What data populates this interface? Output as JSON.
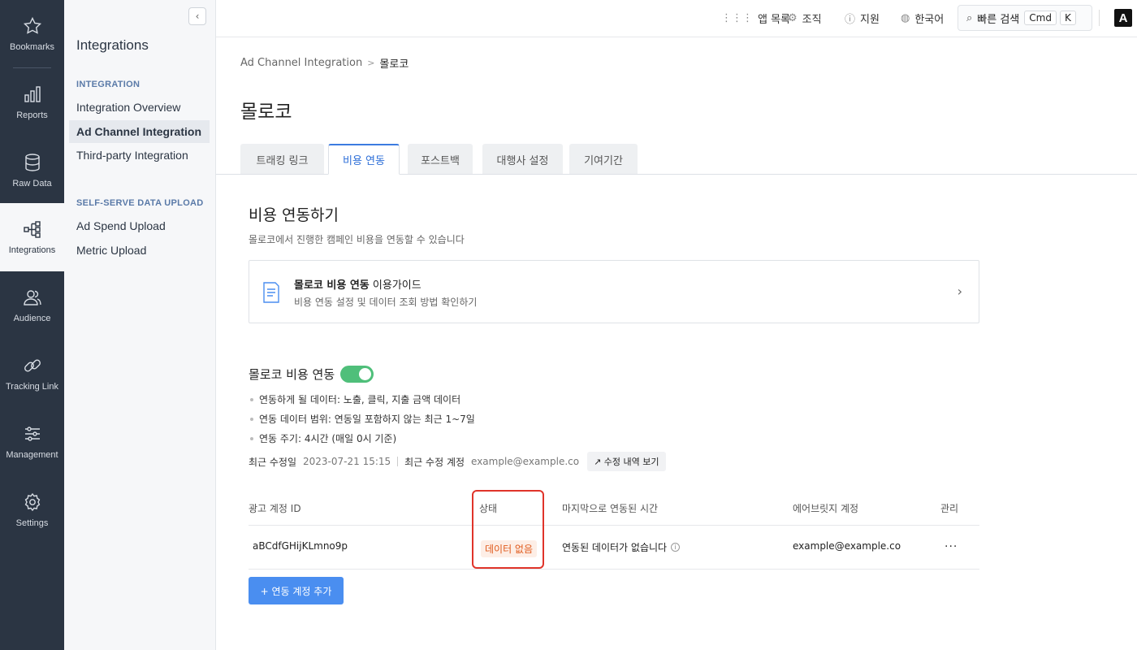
{
  "nav": {
    "items": [
      {
        "label": "Bookmarks",
        "icon": "star-icon"
      },
      {
        "label": "Reports",
        "icon": "bar-chart-icon"
      },
      {
        "label": "Raw Data",
        "icon": "database-icon"
      },
      {
        "label": "Integrations",
        "icon": "integration-icon",
        "active": true
      },
      {
        "label": "Audience",
        "icon": "users-icon"
      },
      {
        "label": "Tracking Link",
        "icon": "link-icon"
      },
      {
        "label": "Management",
        "icon": "sliders-icon"
      },
      {
        "label": "Settings",
        "icon": "gear-icon"
      }
    ]
  },
  "sidebar": {
    "collapse_glyph": "‹",
    "title": "Integrations",
    "section1": "INTEGRATION",
    "items1": [
      "Integration Overview",
      "Ad Channel Integration",
      "Third-party Integration"
    ],
    "section2": "SELF-SERVE DATA UPLOAD",
    "items2": [
      "Ad Spend Upload",
      "Metric Upload"
    ]
  },
  "topbar": {
    "app_list": "앱 목록",
    "org": "조직",
    "support": "지원",
    "language": "한국어",
    "search": "빠른 검색",
    "kbd1": "Cmd",
    "kbd2": "K",
    "logo": "A"
  },
  "breadcrumb": {
    "parent": "Ad Channel Integration",
    "sep": ">",
    "current": "몰로코"
  },
  "page_title": "몰로코",
  "tabs": [
    "트래킹 링크",
    "비용 연동",
    "포스트백",
    "대행사 설정",
    "기여기간"
  ],
  "section": {
    "title": "비용 연동하기",
    "subtitle": "몰로코에서 진행한 캠페인 비용을 연동할 수 있습니다"
  },
  "guide": {
    "title_bold": "몰로코 비용 연동",
    "title_rest": " 이용가이드",
    "subtitle": "비용 연동 설정 및 데이터 조회 방법 확인하기",
    "chevron": "›"
  },
  "integration": {
    "title": "몰로코 비용 연동",
    "enabled": true,
    "bullets": [
      "연동하게 될 데이터: 노출, 클릭, 지출 금액 데이터",
      "연동 데이터 범위: 연동일 포함하지 않는 최근 1~7일",
      "연동 주기: 4시간 (매일 0시 기준)"
    ],
    "modified_label": "최근 수정일",
    "modified_value": "2023-07-21 15:15",
    "account_label": "최근 수정 계정",
    "account_value": "example@example.co",
    "history_button": "↗ 수정 내역 보기"
  },
  "table": {
    "headers": [
      "광고 계정 ID",
      "상태",
      "마지막으로 연동된 시간",
      "에어브릿지 계정",
      "관리"
    ],
    "rows": [
      {
        "id": "aBCdfGHijKLmno9p",
        "status": "데이터 없음",
        "last_sync": "연동된 데이터가 없습니다",
        "account": "example@example.co",
        "manage": "···"
      }
    ]
  },
  "add_button": "+ 연동 계정 추가",
  "colors": {
    "accent": "#3c7be0",
    "toggle_on": "#4fbf7a",
    "status_warn": "#e05a1c",
    "highlight": "#e0342a",
    "nav_bg": "#2b3543"
  }
}
